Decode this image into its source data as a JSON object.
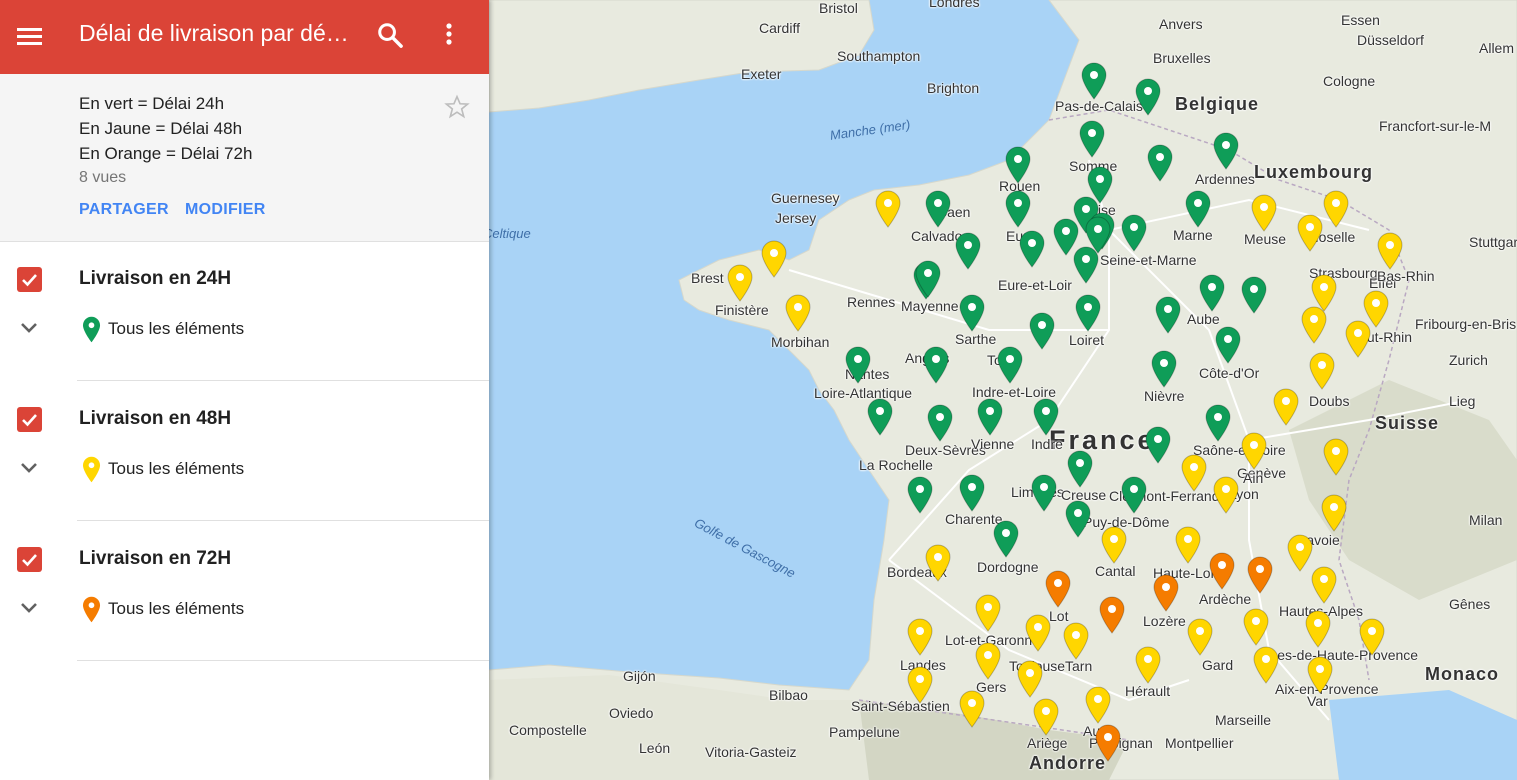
{
  "header": {
    "title": "Délai de livraison par département",
    "menu_icon": "menu-icon",
    "search_icon": "search-icon",
    "more_icon": "more-vert-icon"
  },
  "description": {
    "lines": [
      "En vert = Délai 24h",
      "En Jaune = Délai 48h",
      "En Orange = Délai 72h"
    ],
    "views": "8 vues",
    "share_label": "PARTAGER",
    "edit_label": "MODIFIER"
  },
  "layers": [
    {
      "title": "Livraison en 24H",
      "items_label": "Tous les éléments",
      "color": "#0f9d58",
      "checked": true
    },
    {
      "title": "Livraison en 48H",
      "items_label": "Tous les éléments",
      "color": "#ffd600",
      "checked": true
    },
    {
      "title": "Livraison en 72H",
      "items_label": "Tous les éléments",
      "color": "#f57c00",
      "checked": true
    }
  ],
  "colors": {
    "header": "#db4437",
    "link": "#4285f4",
    "green": "#0f9d58",
    "yellow": "#ffd600",
    "orange": "#f57c00",
    "sea": "#a9d3f6",
    "land": "#e8eadf"
  },
  "map": {
    "water_labels": [
      "Manche (mer)",
      "Golfe de Gascogne",
      "Celtique"
    ],
    "country_labels": [
      "France",
      "Belgique",
      "Luxembourg",
      "Suisse",
      "Monaco",
      "Andorre"
    ],
    "city_labels": [
      "Londres",
      "Bristol",
      "Cardiff",
      "Southampton",
      "Exeter",
      "Brighton",
      "Anvers",
      "Bruxelles",
      "Essen",
      "Düsseldorf",
      "Cologne",
      "Francfort-sur-le-M",
      "Stuttgar",
      "Zurich",
      "Milan",
      "Gênes",
      "Marseille",
      "Toulouse",
      "Bordeaux",
      "Bilbao",
      "Oviedo",
      "Gijón",
      "León",
      "Saint-Sébastien",
      "Pampelune",
      "Vitoria-Gasteiz",
      "Compostelle",
      "Nantes",
      "Rennes",
      "Brest",
      "Rouen",
      "Guernesey",
      "Jersey",
      "La Rochelle",
      "Limoges",
      "Clermont-Ferrand",
      "Lyon",
      "Genève",
      "Montpellier",
      "Perpignan",
      "Fribourg-en-Bris",
      "Strasbourg",
      "Lieg",
      "Allem",
      "Eifel",
      "Tours",
      "Angers",
      "Caen"
    ],
    "department_labels": [
      "Pas-de-Calais",
      "Somme",
      "Ardennes",
      "Calvados",
      "Eure",
      "Oise",
      "Marne",
      "Meuse",
      "Moselle",
      "Bas-Rhin",
      "Seine-et-Marne",
      "Finistère",
      "Mayenne",
      "Eure-et-Loir",
      "Aube",
      "Morbihan",
      "Sarthe",
      "Loiret",
      "Haut-Rhin",
      "Côte-d'Or",
      "Loire-Atlantique",
      "Indre-et-Loire",
      "Nièvre",
      "Doubs",
      "Deux-Sèvres",
      "Vienne",
      "Indre",
      "Saône-et-Loire",
      "Ain",
      "Creuse",
      "Charente",
      "Puy-de-Dôme",
      "Savoie",
      "Dordogne",
      "Cantal",
      "Haute-Loire",
      "Ardèche",
      "Lot",
      "Lozère",
      "Hautes-Alpes",
      "Lot-et-Garonne",
      "Gard",
      "Alpes-de-Haute-Provence",
      "Landes",
      "Tarn",
      "Hérault",
      "Aix-en-Provence",
      "Gers",
      "Var",
      "Ariège",
      "Aude"
    ]
  }
}
